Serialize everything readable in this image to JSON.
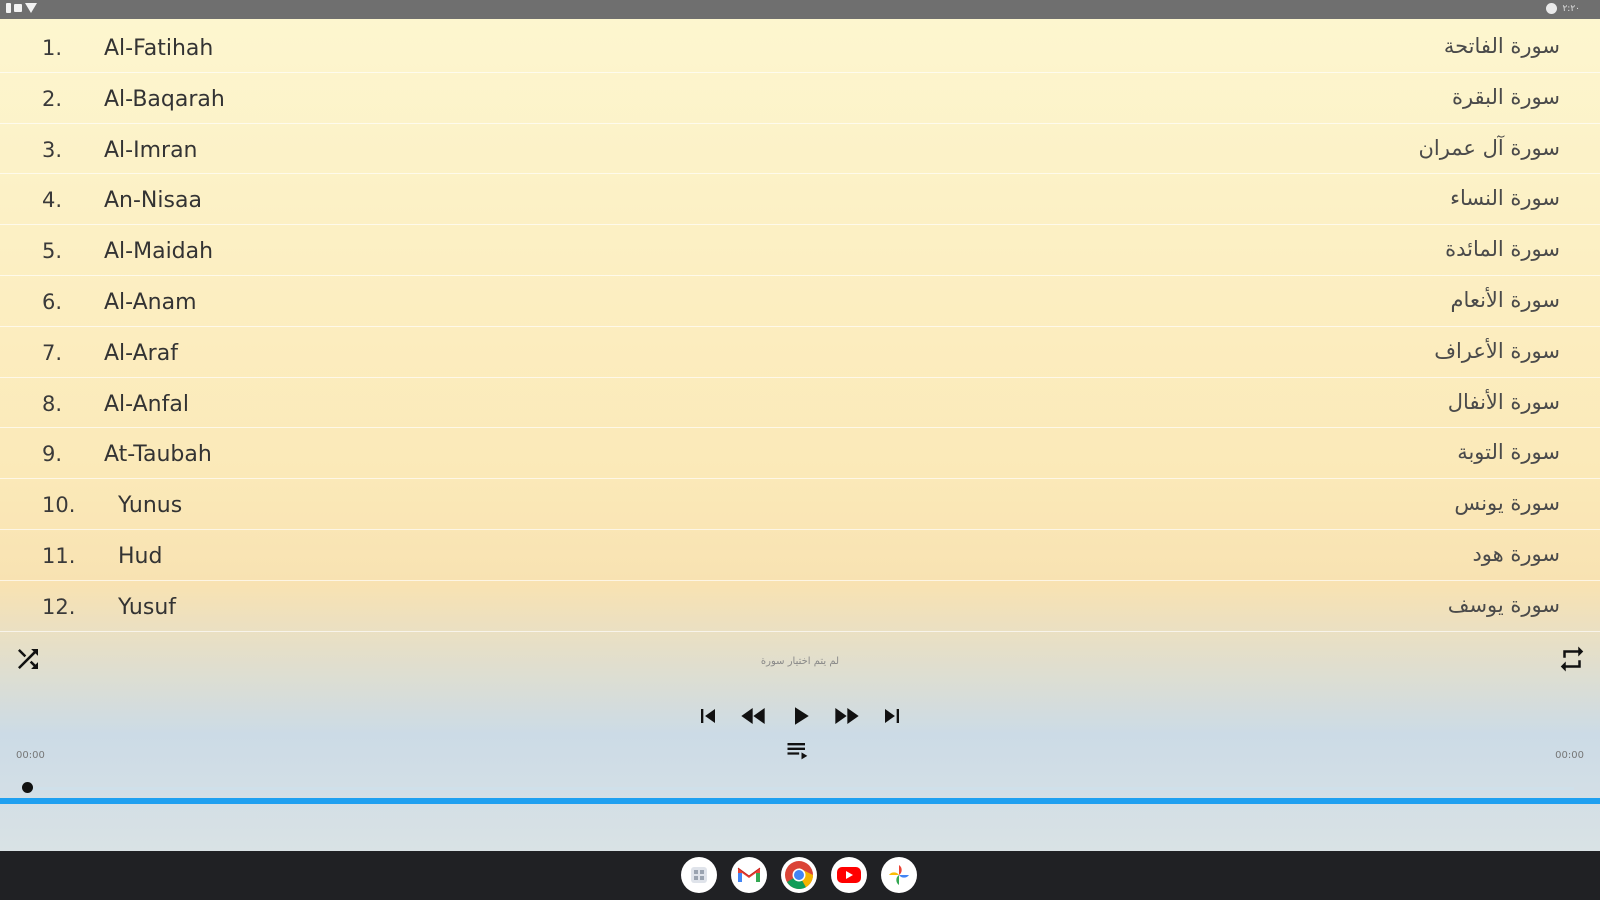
{
  "status_bar": {
    "time": "٢:٢٠"
  },
  "surahs": [
    {
      "number": "1.",
      "name": "Al-Fatihah",
      "arabic": "سورة الفاتحة"
    },
    {
      "number": "2.",
      "name": "Al-Baqarah",
      "arabic": "سورة البقرة"
    },
    {
      "number": "3.",
      "name": "Al-Imran",
      "arabic": "سورة آل عمران"
    },
    {
      "number": "4.",
      "name": "An-Nisaa",
      "arabic": "سورة النساء"
    },
    {
      "number": "5.",
      "name": "Al-Maidah",
      "arabic": "سورة المائدة"
    },
    {
      "number": "6.",
      "name": "Al-Anam",
      "arabic": "سورة الأنعام"
    },
    {
      "number": "7.",
      "name": "Al-Araf",
      "arabic": "سورة الأعراف"
    },
    {
      "number": "8.",
      "name": "Al-Anfal",
      "arabic": "سورة الأنفال"
    },
    {
      "number": "9.",
      "name": "At-Taubah",
      "arabic": "سورة التوبة"
    },
    {
      "number": "10.",
      "name": "Yunus",
      "arabic": "سورة يونس"
    },
    {
      "number": "11.",
      "name": "Hud",
      "arabic": "سورة هود"
    },
    {
      "number": "12.",
      "name": "Yusuf",
      "arabic": "سورة يوسف"
    }
  ],
  "player": {
    "now_playing": "لم يتم اختيار سورة",
    "time_elapsed": "00:00",
    "time_total": "00:00",
    "progress": 0,
    "icons": {
      "shuffle": "shuffle-icon",
      "repeat": "repeat-icon",
      "skip_previous": "skip-previous-icon",
      "rewind": "rewind-icon",
      "play": "play-icon",
      "fast_forward": "fast-forward-icon",
      "skip_next": "skip-next-icon",
      "playlist": "playlist-icon"
    }
  },
  "taskbar": {
    "apps": [
      "launcher",
      "gmail",
      "chrome",
      "youtube",
      "photos"
    ]
  },
  "colors": {
    "accent_line": "#1fa0f0",
    "list_background_top": "#fdf6cf",
    "taskbar": "#202124"
  }
}
